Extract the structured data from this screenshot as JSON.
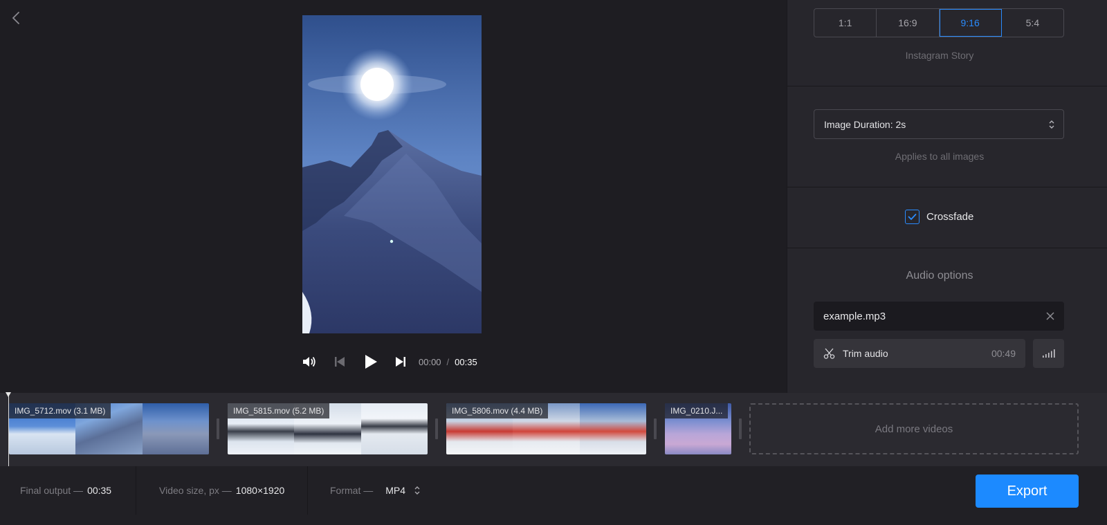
{
  "preview": {
    "time_current": "00:00",
    "time_separator": "/",
    "time_total": "00:35"
  },
  "sidebar": {
    "aspect_ratios": [
      "1:1",
      "16:9",
      "9:16",
      "5:4"
    ],
    "aspect_selected": "9:16",
    "aspect_caption": "Instagram Story",
    "image_duration_label": "Image Duration: 2s",
    "image_duration_caption": "Applies to all images",
    "crossfade_label": "Crossfade",
    "crossfade_checked": true,
    "audio_title": "Audio options",
    "audio_file": "example.mp3",
    "trim_label": "Trim audio",
    "trim_time": "00:49"
  },
  "timeline": {
    "clips": [
      {
        "label": "IMG_5712.mov (3.1 MB)"
      },
      {
        "label": "IMG_5815.mov (5.2 MB)"
      },
      {
        "label": "IMG_5806.mov (4.4 MB)"
      },
      {
        "label": "IMG_0210.J..."
      }
    ],
    "add_more_label": "Add more videos"
  },
  "footer": {
    "final_output_label": "Final output —",
    "final_output_value": "00:35",
    "video_size_label": "Video size, px —",
    "video_size_value": "1080×1920",
    "format_label": "Format —",
    "format_value": "MP4",
    "export_label": "Export"
  },
  "colors": {
    "accent": "#1c8aff",
    "background": "#1e1d22",
    "sidebar": "#27262c"
  }
}
